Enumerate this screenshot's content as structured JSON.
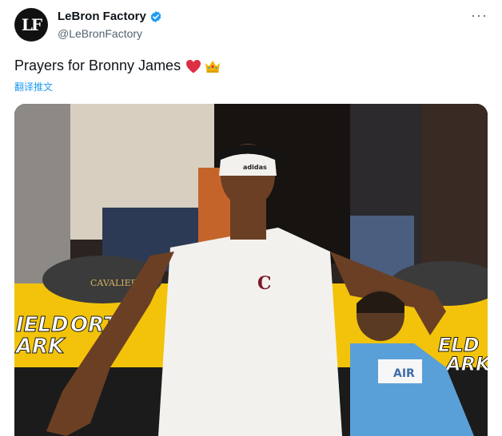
{
  "tweet": {
    "display_name": "LeBron Factory",
    "handle": "@LeBronFactory",
    "avatar_text": "LF",
    "more_label": "···",
    "text": "Prayers for Bronny James",
    "translate_label": "翻译推文",
    "icons": {
      "verified": "verified-badge-icon",
      "heart": "red-heart-emoji",
      "crown": "crown-emoji",
      "more": "more-icon"
    },
    "media": {
      "alt": "",
      "jersey_logos": [
        "adidas",
        "C"
      ],
      "shirt_text": "AIR",
      "signage_text": [
        "IELD",
        "ARK",
        "ORTE",
        "ELD",
        "ARK"
      ],
      "chair_text": "CAVALIERS"
    },
    "colors": {
      "accent": "#1d9bf0",
      "heart": "#e0245e"
    }
  }
}
